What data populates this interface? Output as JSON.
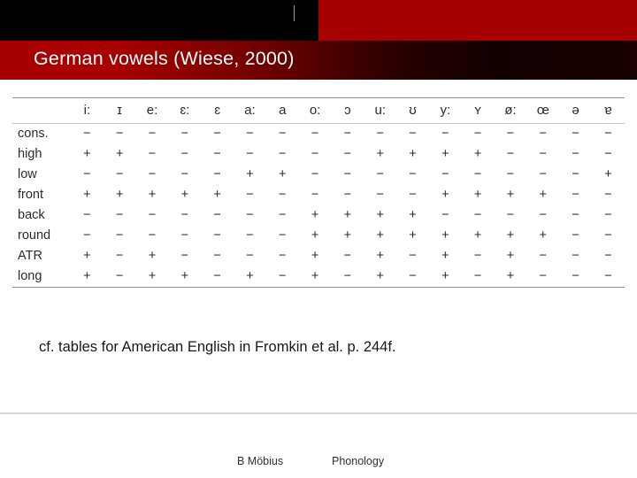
{
  "slide": {
    "title": "German vowels (Wiese, 2000)",
    "caption": "cf. tables for American English in Fromkin et al. p. 244f."
  },
  "footer": {
    "author": "B Möbius",
    "topic": "Phonology"
  },
  "colors": {
    "banner_red": "#a60000",
    "banner_black": "#000000",
    "title_text": "#ffffff",
    "rule": "#8a8a8a"
  },
  "table": {
    "corner_label": "",
    "columns": [
      "i:",
      "ɪ",
      "e:",
      "ɛ:",
      "ɛ",
      "a:",
      "a",
      "o:",
      "ɔ",
      "u:",
      "ʊ",
      "y:",
      "ʏ",
      "ø:",
      "œ",
      "ə",
      "ɐ"
    ],
    "rows": [
      {
        "label": "cons.",
        "values": [
          "−",
          "−",
          "−",
          "−",
          "−",
          "−",
          "−",
          "−",
          "−",
          "−",
          "−",
          "−",
          "−",
          "−",
          "−",
          "−",
          "−"
        ]
      },
      {
        "label": "high",
        "values": [
          "+",
          "+",
          "−",
          "−",
          "−",
          "−",
          "−",
          "−",
          "−",
          "+",
          "+",
          "+",
          "+",
          "−",
          "−",
          "−",
          "−"
        ]
      },
      {
        "label": "low",
        "values": [
          "−",
          "−",
          "−",
          "−",
          "−",
          "+",
          "+",
          "−",
          "−",
          "−",
          "−",
          "−",
          "−",
          "−",
          "−",
          "−",
          "+"
        ]
      },
      {
        "label": "front",
        "values": [
          "+",
          "+",
          "+",
          "+",
          "+",
          "−",
          "−",
          "−",
          "−",
          "−",
          "−",
          "+",
          "+",
          "+",
          "+",
          "−",
          "−"
        ]
      },
      {
        "label": "back",
        "values": [
          "−",
          "−",
          "−",
          "−",
          "−",
          "−",
          "−",
          "+",
          "+",
          "+",
          "+",
          "−",
          "−",
          "−",
          "−",
          "−",
          "−"
        ]
      },
      {
        "label": "round",
        "values": [
          "−",
          "−",
          "−",
          "−",
          "−",
          "−",
          "−",
          "+",
          "+",
          "+",
          "+",
          "+",
          "+",
          "+",
          "+",
          "−",
          "−"
        ]
      },
      {
        "label": "ATR",
        "values": [
          "+",
          "−",
          "+",
          "−",
          "−",
          "−",
          "−",
          "+",
          "−",
          "+",
          "−",
          "+",
          "−",
          "+",
          "−",
          "−",
          "−"
        ]
      },
      {
        "label": "long",
        "values": [
          "+",
          "−",
          "+",
          "+",
          "−",
          "+",
          "−",
          "+",
          "−",
          "+",
          "−",
          "+",
          "−",
          "+",
          "−",
          "−",
          "−"
        ]
      }
    ]
  }
}
